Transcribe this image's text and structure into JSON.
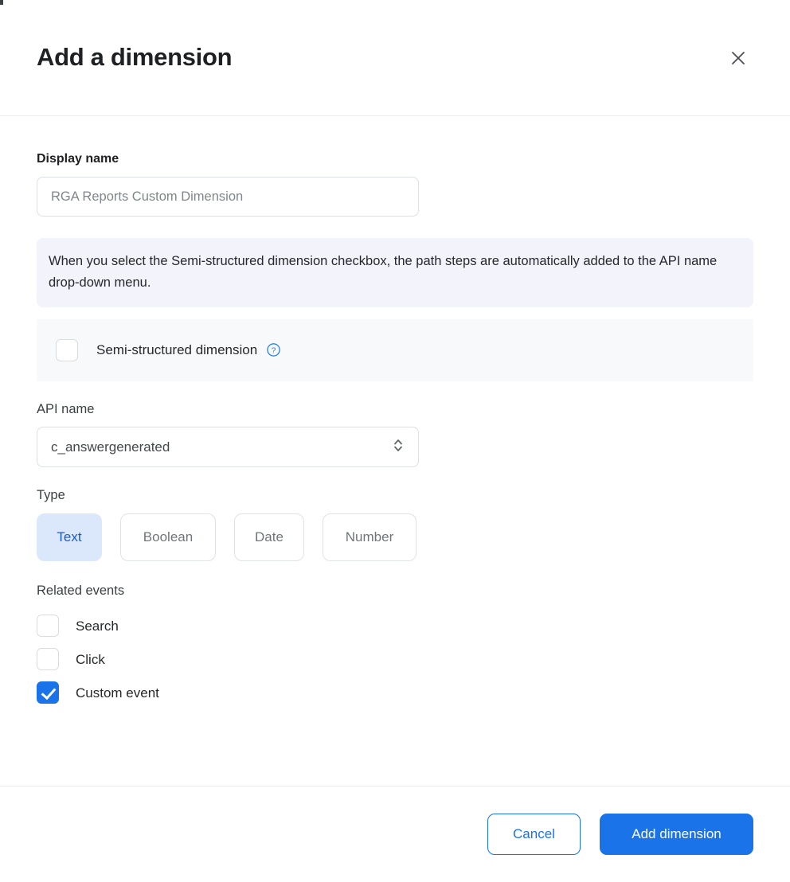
{
  "dialog": {
    "title": "Add a dimension",
    "close_icon": "close-icon"
  },
  "display_name": {
    "label": "Display name",
    "value": "RGA Reports Custom Dimension",
    "placeholder": "RGA Reports Custom Dimension"
  },
  "info_banner": {
    "text": "When you select the Semi-structured dimension checkbox, the path steps are automatically added to the API name drop-down menu."
  },
  "semi_structured": {
    "label": "Semi-structured dimension",
    "checked": false,
    "help_icon": "help-circle-icon"
  },
  "api_name": {
    "label": "API name",
    "value": "c_answergenerated",
    "chevron_icon": "chevron-up-down-icon"
  },
  "type": {
    "label": "Type",
    "selected": "Text",
    "options": [
      {
        "label": "Text",
        "selected": true
      },
      {
        "label": "Boolean",
        "selected": false
      },
      {
        "label": "Date",
        "selected": false
      },
      {
        "label": "Number",
        "selected": false
      }
    ]
  },
  "related_events": {
    "label": "Related events",
    "items": [
      {
        "label": "Search",
        "checked": false
      },
      {
        "label": "Click",
        "checked": false
      },
      {
        "label": "Custom event",
        "checked": true
      }
    ]
  },
  "footer": {
    "cancel_label": "Cancel",
    "submit_label": "Add dimension"
  },
  "colors": {
    "accent_blue": "#1a73e8",
    "selected_chip_bg": "#dbe8fc",
    "selected_chip_text": "#1b5cc4",
    "info_banner_bg": "#f2f3fb",
    "row_bg": "#f8f9fa"
  }
}
